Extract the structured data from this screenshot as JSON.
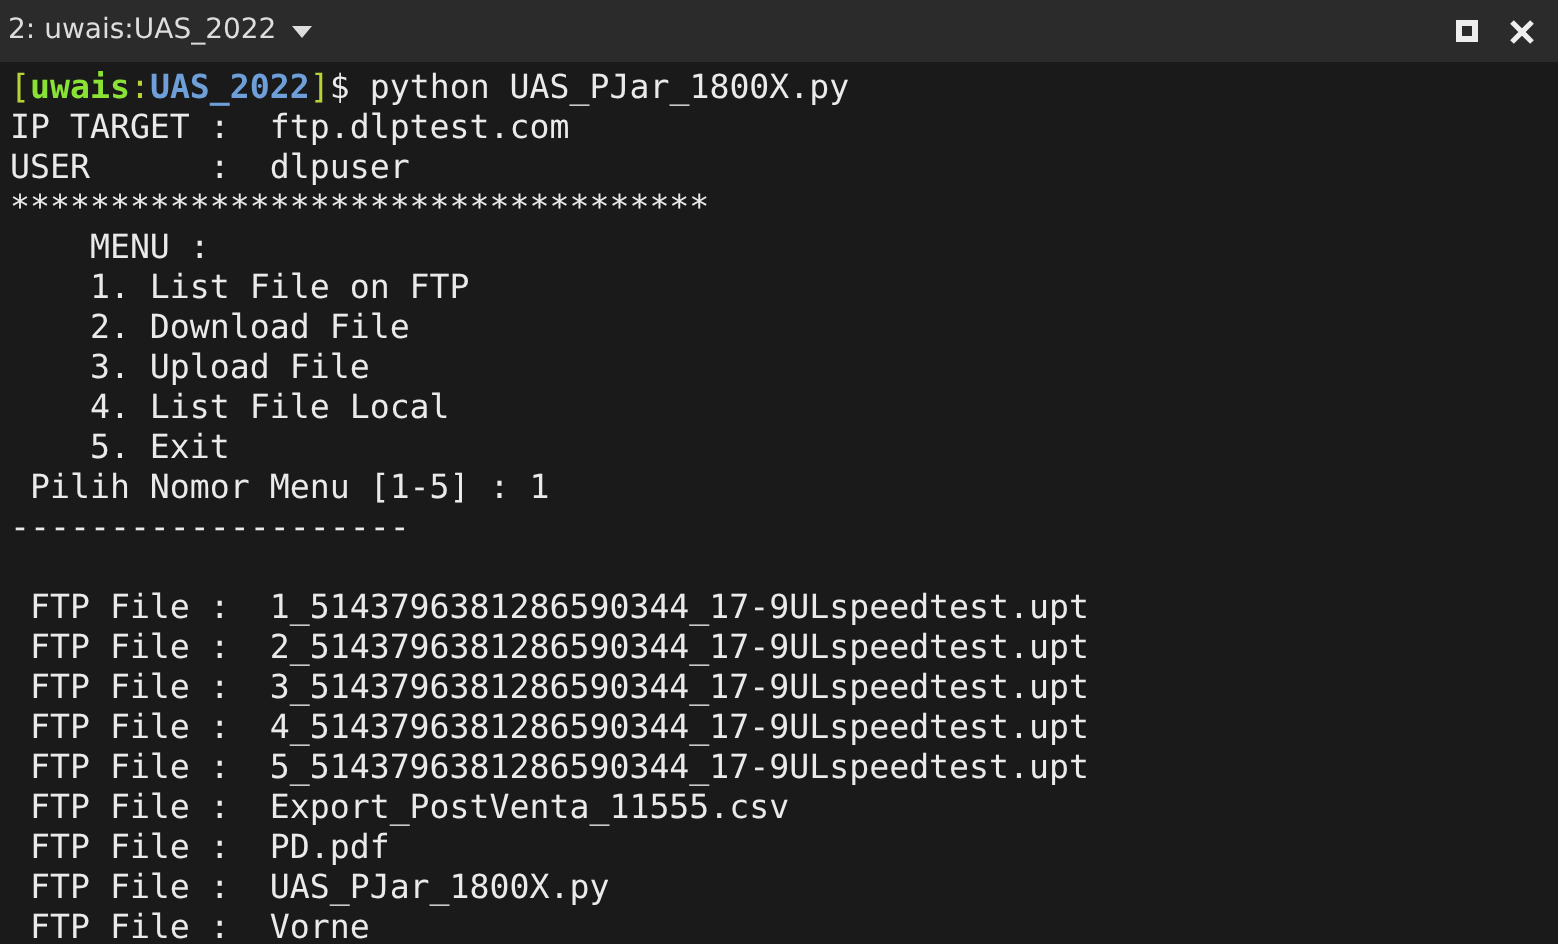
{
  "window": {
    "title": "2: uwais:UAS_2022"
  },
  "lines": [
    {
      "kind": "prompt",
      "segments": [
        {
          "kind": "punct",
          "text": "["
        },
        {
          "kind": "user",
          "text": "uwais"
        },
        {
          "kind": "punct",
          "text": ":"
        },
        {
          "kind": "dir",
          "text": "UAS_2022"
        },
        {
          "kind": "punct",
          "text": "]"
        },
        {
          "kind": "plain",
          "text": "$ python UAS_PJar_1800X.py"
        }
      ]
    },
    {
      "kind": "text",
      "text": "IP TARGET :  ftp.dlptest.com"
    },
    {
      "kind": "text",
      "text": "USER      :  dlpuser"
    },
    {
      "kind": "text",
      "text": "***********************************"
    },
    {
      "kind": "text",
      "text": "    MENU :"
    },
    {
      "kind": "text",
      "text": "    1. List File on FTP"
    },
    {
      "kind": "text",
      "text": "    2. Download File"
    },
    {
      "kind": "text",
      "text": "    3. Upload File"
    },
    {
      "kind": "text",
      "text": "    4. List File Local"
    },
    {
      "kind": "text",
      "text": "    5. Exit"
    },
    {
      "kind": "text",
      "text": " Pilih Nomor Menu [1-5] : 1"
    },
    {
      "kind": "text",
      "text": "--------------------"
    },
    {
      "kind": "blank"
    },
    {
      "kind": "text",
      "text": " FTP File :  1_5143796381286590344_17-9ULspeedtest.upt"
    },
    {
      "kind": "text",
      "text": " FTP File :  2_5143796381286590344_17-9ULspeedtest.upt"
    },
    {
      "kind": "text",
      "text": " FTP File :  3_5143796381286590344_17-9ULspeedtest.upt"
    },
    {
      "kind": "text",
      "text": " FTP File :  4_5143796381286590344_17-9ULspeedtest.upt"
    },
    {
      "kind": "text",
      "text": " FTP File :  5_5143796381286590344_17-9ULspeedtest.upt"
    },
    {
      "kind": "text",
      "text": " FTP File :  Export_PostVenta_11555.csv"
    },
    {
      "kind": "text",
      "text": " FTP File :  PD.pdf"
    },
    {
      "kind": "text",
      "text": " FTP File :  UAS_PJar_1800X.py"
    },
    {
      "kind": "text",
      "text": " FTP File :  Vorne"
    }
  ]
}
